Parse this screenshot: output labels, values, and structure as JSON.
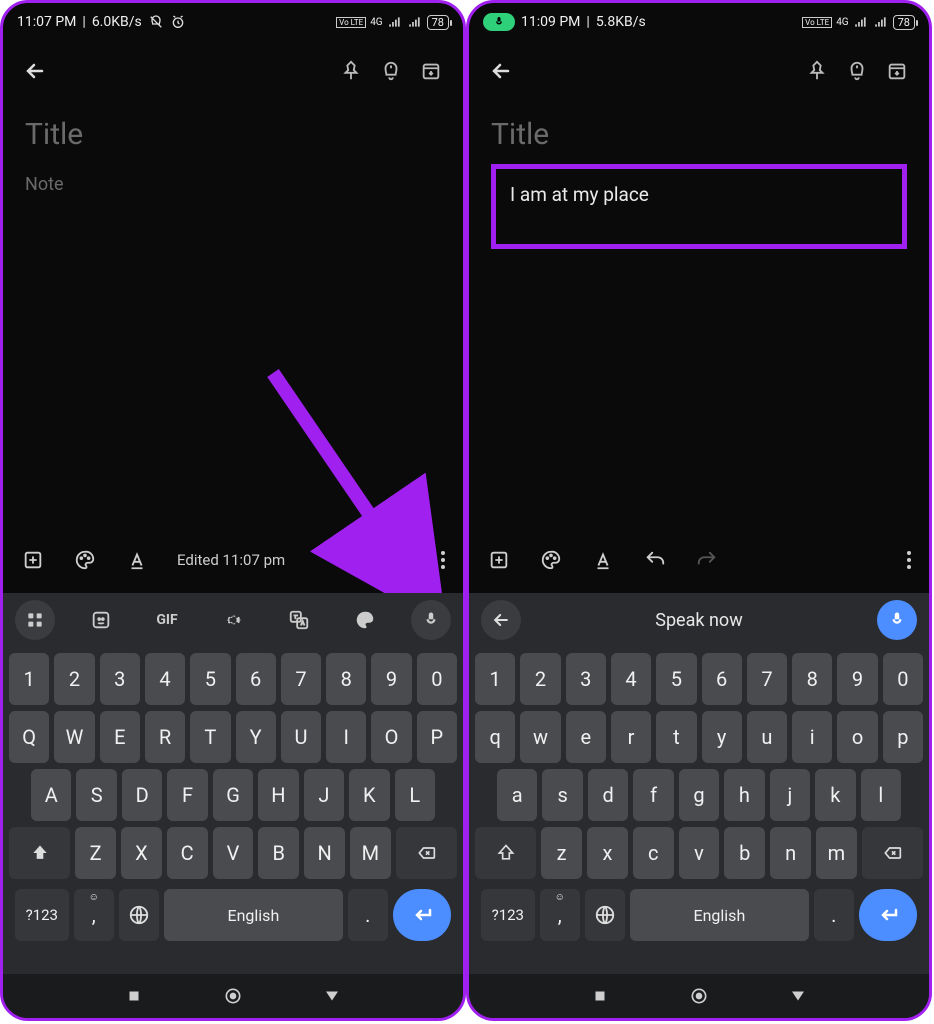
{
  "left": {
    "statusbar": {
      "time": "11:07 PM",
      "speed": "6.0KB/s",
      "volte": "Vo LTE",
      "network": "4G",
      "battery": "78"
    },
    "title_placeholder": "Title",
    "note_placeholder": "Note",
    "edited_label": "Edited 11:07 pm",
    "keyboard": {
      "gif_label": "GIF",
      "row_nums": [
        "1",
        "2",
        "3",
        "4",
        "5",
        "6",
        "7",
        "8",
        "9",
        "0"
      ],
      "row1": [
        "Q",
        "W",
        "E",
        "R",
        "T",
        "Y",
        "U",
        "I",
        "O",
        "P"
      ],
      "row2": [
        "A",
        "S",
        "D",
        "F",
        "G",
        "H",
        "J",
        "K",
        "L"
      ],
      "row3": [
        "Z",
        "X",
        "C",
        "V",
        "B",
        "N",
        "M"
      ],
      "sym_label": "?123",
      "comma": ",",
      "period": ".",
      "space_label": "English"
    }
  },
  "right": {
    "statusbar": {
      "time": "11:09 PM",
      "speed": "5.8KB/s",
      "volte": "Vo LTE",
      "network": "4G",
      "battery": "78"
    },
    "title_placeholder": "Title",
    "note_text": "I am at my place",
    "keyboard": {
      "speak_label": "Speak now",
      "row_nums": [
        "1",
        "2",
        "3",
        "4",
        "5",
        "6",
        "7",
        "8",
        "9",
        "0"
      ],
      "row1": [
        "q",
        "w",
        "e",
        "r",
        "t",
        "y",
        "u",
        "i",
        "o",
        "p"
      ],
      "row2": [
        "a",
        "s",
        "d",
        "f",
        "g",
        "h",
        "j",
        "k",
        "l"
      ],
      "row3": [
        "z",
        "x",
        "c",
        "v",
        "b",
        "n",
        "m"
      ],
      "sym_label": "?123",
      "comma": ",",
      "period": ".",
      "space_label": "English"
    }
  }
}
